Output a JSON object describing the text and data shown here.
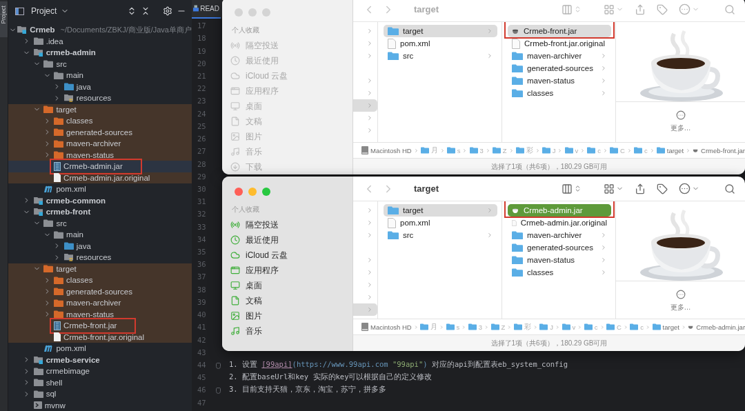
{
  "ide": {
    "tool_strip_label": "Project",
    "project_panel": {
      "title": "Project",
      "tree": [
        {
          "name": "Crmeb",
          "kind": "module",
          "hint": "~/Documents/ZBKJ/商业版/Java单商户",
          "expanded": true,
          "children": [
            {
              "name": ".idea",
              "kind": "folder",
              "expanded": false
            },
            {
              "name": "crmeb-admin",
              "kind": "module",
              "expanded": true,
              "children": [
                {
                  "name": "src",
                  "kind": "folder",
                  "expanded": true,
                  "children": [
                    {
                      "name": "main",
                      "kind": "folder",
                      "expanded": true,
                      "children": [
                        {
                          "name": "java",
                          "kind": "source",
                          "expanded": false
                        },
                        {
                          "name": "resources",
                          "kind": "resources",
                          "expanded": false
                        }
                      ]
                    }
                  ]
                },
                {
                  "name": "target",
                  "kind": "excluded",
                  "expanded": true,
                  "children": [
                    {
                      "name": "classes",
                      "kind": "excluded",
                      "expanded": false
                    },
                    {
                      "name": "generated-sources",
                      "kind": "excluded",
                      "expanded": false
                    },
                    {
                      "name": "maven-archiver",
                      "kind": "excluded",
                      "expanded": false
                    },
                    {
                      "name": "maven-status",
                      "kind": "excluded",
                      "expanded": false
                    },
                    {
                      "name": "Crmeb-admin.jar",
                      "kind": "jar",
                      "selected": true,
                      "framed": true
                    },
                    {
                      "name": "Crmeb-admin.jar.original",
                      "kind": "file",
                      "selected": false,
                      "framed": false
                    }
                  ]
                },
                {
                  "name": "pom.xml",
                  "kind": "maven",
                  "selected": false,
                  "framed": false
                }
              ]
            },
            {
              "name": "crmeb-common",
              "kind": "module",
              "expanded": false
            },
            {
              "name": "crmeb-front",
              "kind": "module",
              "expanded": true,
              "children": [
                {
                  "name": "src",
                  "kind": "folder",
                  "expanded": true,
                  "children": [
                    {
                      "name": "main",
                      "kind": "folder",
                      "expanded": true,
                      "children": [
                        {
                          "name": "java",
                          "kind": "source",
                          "expanded": false
                        },
                        {
                          "name": "resources",
                          "kind": "resources",
                          "expanded": false
                        }
                      ]
                    }
                  ]
                },
                {
                  "name": "target",
                  "kind": "excluded",
                  "expanded": true,
                  "children": [
                    {
                      "name": "classes",
                      "kind": "excluded",
                      "expanded": false
                    },
                    {
                      "name": "generated-sources",
                      "kind": "excluded",
                      "expanded": false
                    },
                    {
                      "name": "maven-archiver",
                      "kind": "excluded",
                      "expanded": false
                    },
                    {
                      "name": "maven-status",
                      "kind": "excluded",
                      "expanded": false
                    },
                    {
                      "name": "Crmeb-front.jar",
                      "kind": "jar",
                      "selected": false,
                      "framed": true
                    },
                    {
                      "name": "Crmeb-front.jar.original",
                      "kind": "file",
                      "selected": false,
                      "framed": false
                    }
                  ]
                },
                {
                  "name": "pom.xml",
                  "kind": "maven",
                  "selected": false,
                  "framed": false
                }
              ]
            },
            {
              "name": "crmeb-service",
              "kind": "module",
              "expanded": false
            },
            {
              "name": "crmebimage",
              "kind": "folder",
              "expanded": false
            },
            {
              "name": "shell",
              "kind": "folder",
              "expanded": false
            },
            {
              "name": "sql",
              "kind": "folder",
              "expanded": false
            },
            {
              "name": "mvnw",
              "kind": "script",
              "selected": false,
              "framed": false
            }
          ]
        }
      ]
    },
    "editor": {
      "tab": "READ",
      "lines": [
        {
          "number": "17"
        },
        {
          "number": "18"
        },
        {
          "number": "19"
        },
        {
          "number": "20"
        },
        {
          "number": "21"
        },
        {
          "number": "22"
        },
        {
          "number": "23"
        },
        {
          "number": "24"
        },
        {
          "number": "25"
        },
        {
          "number": "26"
        },
        {
          "number": "27"
        },
        {
          "number": "28"
        },
        {
          "number": "29"
        },
        {
          "number": "30"
        },
        {
          "number": "31"
        },
        {
          "number": "32"
        },
        {
          "number": "33"
        },
        {
          "number": "34"
        },
        {
          "number": "35"
        },
        {
          "number": "36"
        },
        {
          "number": "37"
        },
        {
          "number": "38"
        },
        {
          "number": "39"
        },
        {
          "number": "40"
        },
        {
          "number": "41"
        },
        {
          "number": "42"
        },
        {
          "number": "43"
        },
        {
          "number": "44",
          "fold": true,
          "segments": [
            {
              "kind": "text",
              "text": "1. 设置 "
            },
            {
              "kind": "link",
              "text": "[99api]"
            },
            {
              "kind": "url",
              "text": "(https://www.99api.com "
            },
            {
              "kind": "string",
              "text": "\"99api\""
            },
            {
              "kind": "url",
              "text": ")"
            },
            {
              "kind": "text",
              "text": " 对应的api到配置表eb_system_config"
            }
          ]
        },
        {
          "number": "45",
          "fold": false,
          "segments": [
            {
              "kind": "text",
              "text": "2. 配置baseUrl和key 实际的key可以根据自己的定义修改"
            }
          ]
        },
        {
          "number": "46",
          "fold": true,
          "segments": [
            {
              "kind": "text",
              "text": "3. 目前支持天猫，京东，淘宝，苏宁，拼多多"
            }
          ]
        },
        {
          "number": "47"
        }
      ]
    }
  },
  "finder_windows": [
    {
      "active": false,
      "title": "target",
      "sidebar_heading": "个人收藏",
      "sidebar": [
        "隔空投送",
        "最近使用",
        "iCloud 云盘",
        "应用程序",
        "桌面",
        "文稿",
        "图片",
        "音乐",
        "下载"
      ],
      "parent_column": [
        {
          "kind": "chevron",
          "selected": false
        },
        {
          "kind": "chevron",
          "selected": false
        },
        {
          "kind": "chevron",
          "selected": false
        },
        {
          "kind": "gap"
        },
        {
          "kind": "chevron",
          "selected": false
        },
        {
          "kind": "chevron",
          "selected": false
        },
        {
          "kind": "chevron",
          "selected": true
        },
        {
          "kind": "chevron",
          "selected": false
        },
        {
          "kind": "chevron",
          "selected": false
        }
      ],
      "columns": [
        [
          {
            "name": "target",
            "kind": "folder",
            "selected": true,
            "framed": false
          },
          {
            "name": "pom.xml",
            "kind": "file",
            "selected": false,
            "framed": false
          },
          {
            "name": "src",
            "kind": "folder",
            "selected": false,
            "framed": false
          }
        ],
        [
          {
            "name": "Crmeb-front.jar",
            "kind": "jar",
            "selected": true,
            "framed": true
          },
          {
            "name": "Crmeb-front.jar.original",
            "kind": "file",
            "selected": false,
            "framed": false
          },
          {
            "name": "maven-archiver",
            "kind": "folder",
            "selected": false,
            "framed": false
          },
          {
            "name": "generated-sources",
            "kind": "folder",
            "selected": false,
            "framed": false
          },
          {
            "name": "maven-status",
            "kind": "folder",
            "selected": false,
            "framed": false
          },
          {
            "name": "classes",
            "kind": "folder",
            "selected": false,
            "framed": false
          }
        ]
      ],
      "preview_more": "更多…",
      "path": [
        {
          "label": "Macintosh HD",
          "kind": "disk"
        },
        {
          "label": "月",
          "kind": "folder"
        },
        {
          "label": "s",
          "kind": "folder"
        },
        {
          "label": "3",
          "kind": "folder"
        },
        {
          "label": "Z",
          "kind": "folder"
        },
        {
          "label": "彩",
          "kind": "folder"
        },
        {
          "label": "J",
          "kind": "folder"
        },
        {
          "label": "v",
          "kind": "folder"
        },
        {
          "label": "c",
          "kind": "folder"
        },
        {
          "label": "C",
          "kind": "folder"
        },
        {
          "label": "c",
          "kind": "folder"
        },
        {
          "label": "target",
          "kind": "folder"
        },
        {
          "label": "Crmeb-front.jar",
          "kind": "jar"
        }
      ],
      "status": "选择了1项（共6项），180.29 GB可用"
    },
    {
      "active": true,
      "title": "target",
      "sidebar_heading": "个人收藏",
      "sidebar": [
        "隔空投送",
        "最近使用",
        "iCloud 云盘",
        "应用程序",
        "桌面",
        "文稿",
        "图片",
        "音乐"
      ],
      "parent_column": [
        {
          "kind": "chevron",
          "selected": false
        },
        {
          "kind": "chevron",
          "selected": false
        },
        {
          "kind": "chevron",
          "selected": false
        },
        {
          "kind": "gap"
        },
        {
          "kind": "chevron",
          "selected": false
        },
        {
          "kind": "chevron",
          "selected": false
        },
        {
          "kind": "chevron",
          "selected": false
        },
        {
          "kind": "chevron",
          "selected": false
        },
        {
          "kind": "chevron",
          "selected": true
        }
      ],
      "columns": [
        [
          {
            "name": "target",
            "kind": "folder",
            "selected": true,
            "framed": false
          },
          {
            "name": "pom.xml",
            "kind": "file",
            "selected": false,
            "framed": false
          },
          {
            "name": "src",
            "kind": "folder",
            "selected": false,
            "framed": false
          }
        ],
        [
          {
            "name": "Crmeb-admin.jar",
            "kind": "jar",
            "selected": true,
            "framed": true
          },
          {
            "name": "Crmeb-admin.jar.original",
            "kind": "file",
            "selected": false,
            "framed": false
          },
          {
            "name": "maven-archiver",
            "kind": "folder",
            "selected": false,
            "framed": false
          },
          {
            "name": "generated-sources",
            "kind": "folder",
            "selected": false,
            "framed": false
          },
          {
            "name": "maven-status",
            "kind": "folder",
            "selected": false,
            "framed": false
          },
          {
            "name": "classes",
            "kind": "folder",
            "selected": false,
            "framed": false
          }
        ]
      ],
      "preview_more": "更多…",
      "path": [
        {
          "label": "Macintosh HD",
          "kind": "disk"
        },
        {
          "label": "月",
          "kind": "folder"
        },
        {
          "label": "s",
          "kind": "folder"
        },
        {
          "label": "3",
          "kind": "folder"
        },
        {
          "label": "Z",
          "kind": "folder"
        },
        {
          "label": "彩",
          "kind": "folder"
        },
        {
          "label": "J",
          "kind": "folder"
        },
        {
          "label": "v",
          "kind": "folder"
        },
        {
          "label": "c",
          "kind": "folder"
        },
        {
          "label": "C",
          "kind": "folder"
        },
        {
          "label": "c",
          "kind": "folder"
        },
        {
          "label": "target",
          "kind": "folder"
        },
        {
          "label": "Crmeb-admin.jar",
          "kind": "jar"
        }
      ],
      "status": "选择了1项（共6项），180.29 GB可用"
    }
  ]
}
